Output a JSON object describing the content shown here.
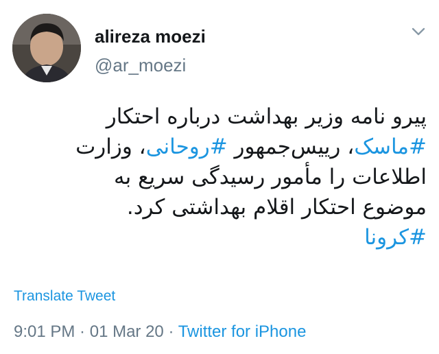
{
  "user": {
    "display_name": "alireza moezi",
    "handle": "@ar_moezi"
  },
  "tweet": {
    "line1": "پیرو نامه وزیر بهداشت درباره احتکار",
    "line2_tag1": "#ماسک",
    "line2_mid": "، رییس‌جمهور ",
    "line2_tag2": "#روحانی",
    "line2_end": "، وزارت",
    "line3": "اطلاعات را مأمور رسیدگی سریع به",
    "line4": "موضوع احتکار اقلام بهداشتی کرد.",
    "line5_tag": "#کرونا"
  },
  "actions": {
    "translate_label": "Translate Tweet"
  },
  "meta": {
    "time": "9:01 PM",
    "sep1": " · ",
    "date": "01 Mar 20",
    "sep2": " · ",
    "source": "Twitter for iPhone"
  },
  "icons": {
    "menu": "chevron-down-icon"
  },
  "colors": {
    "link": "#1b95e0",
    "text": "#14171a",
    "muted": "#657786"
  }
}
